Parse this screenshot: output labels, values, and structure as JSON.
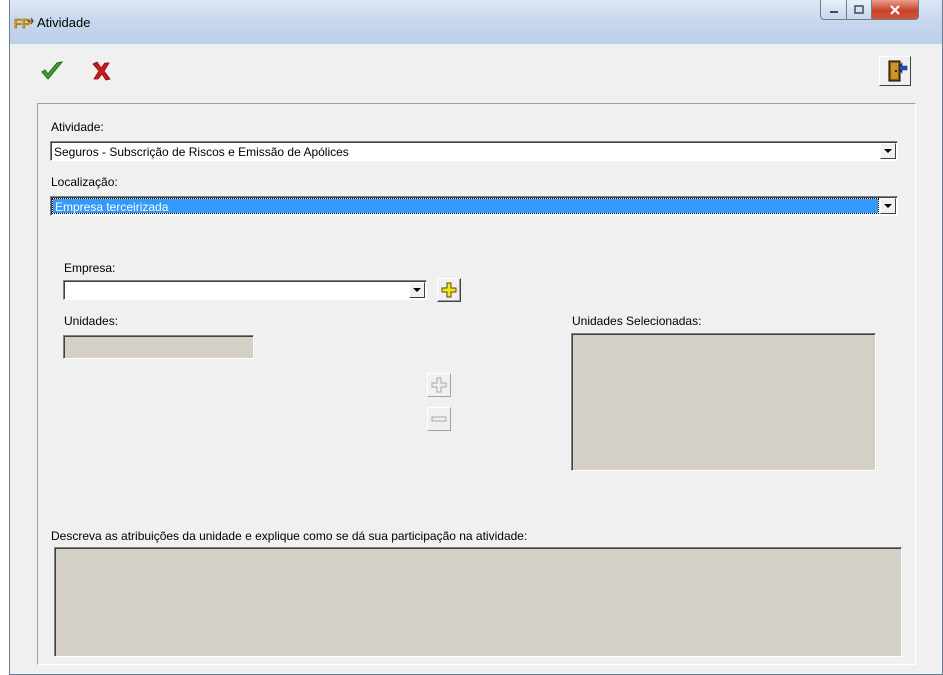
{
  "window": {
    "title": "Atividade",
    "icon": "fp-app-icon",
    "controls": [
      "minimize-icon",
      "maximize-icon",
      "close-icon"
    ]
  },
  "toolbar": {
    "confirm_icon": "green-check-icon",
    "cancel_icon": "red-x-icon",
    "exit_icon": "exit-door-icon"
  },
  "form": {
    "atividade_label": "Atividade:",
    "atividade_value": "Seguros - Subscrição de Riscos e Emissão de Apólices",
    "localizacao_label": "Localização:",
    "localizacao_value": "Empresa terceirizada",
    "empresa_label": "Empresa:",
    "empresa_value": "",
    "unidades_label": "Unidades:",
    "unidades_value": "",
    "unidades_selecionadas_label": "Unidades Selecionadas:",
    "descricao_label": "Descreva as atribuições da unidade e explique como se dá sua participação na atividade:",
    "descricao_value": ""
  },
  "colors": {
    "selection": "#3399ff",
    "disabled_field": "#d4d0c8",
    "add_icon": "#f5e61e",
    "confirm": "#3aa52a",
    "cancel": "#d01818"
  }
}
